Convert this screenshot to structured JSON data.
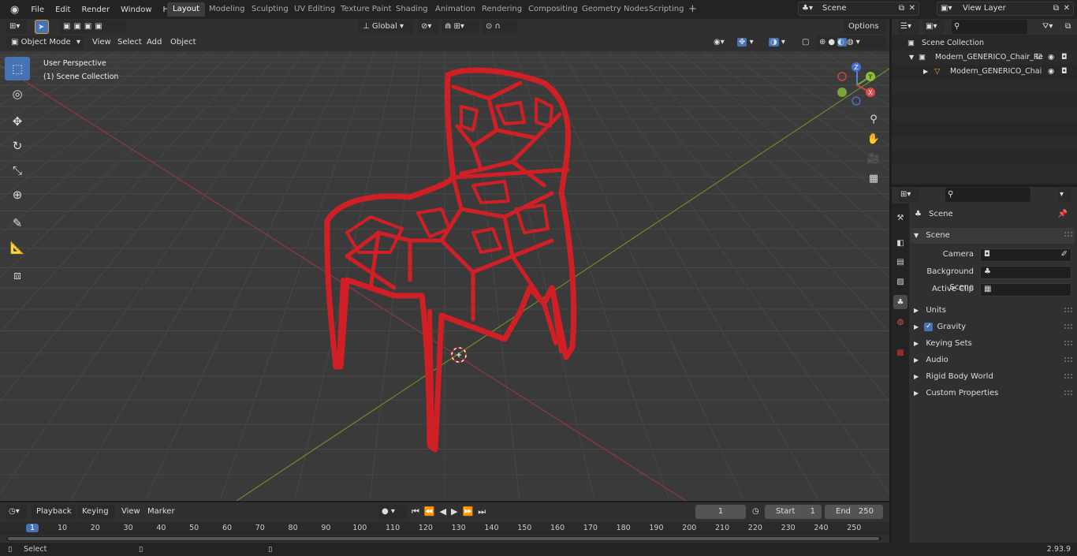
{
  "topbar": {
    "menus": [
      "File",
      "Edit",
      "Render",
      "Window",
      "Help"
    ],
    "workspaces": [
      "Layout",
      "Modeling",
      "Sculpting",
      "UV Editing",
      "Texture Paint",
      "Shading",
      "Animation",
      "Rendering",
      "Compositing",
      "Geometry Nodes",
      "Scripting"
    ],
    "active_workspace": "Layout",
    "add_tab": "+",
    "scene_name": "Scene",
    "view_layer": "View Layer"
  },
  "viewport": {
    "transform_orientation": "Global",
    "options_label": "Options",
    "mode": "Object Mode",
    "menus": [
      "View",
      "Select",
      "Add",
      "Object"
    ],
    "overlay_title": "User Perspective",
    "overlay_collection": "(1) Scene Collection",
    "axis_labels": {
      "z": "Z",
      "y": "Y",
      "x": "X"
    },
    "model_color": "#d11f26",
    "x_axis_color": "#8f3b3b",
    "y_axis_color": "#6a8d2a"
  },
  "outliner": {
    "rows": [
      "Scene Collection",
      "Modern_GENERICO_Chair_Re",
      "Modern_GENERICO_Chai"
    ]
  },
  "properties": {
    "header": "Scene",
    "panel_title": "Scene",
    "fields": [
      {
        "label": "Camera"
      },
      {
        "label": "Background Scene"
      },
      {
        "label": "Active Clip"
      }
    ],
    "sections": [
      "Units",
      "Gravity",
      "Keying Sets",
      "Audio",
      "Rigid Body World",
      "Custom Properties"
    ],
    "gravity_checked": true
  },
  "timeline": {
    "menus": [
      "Playback",
      "Keying",
      "View",
      "Marker"
    ],
    "current_frame": "1",
    "start_label": "Start",
    "start_value": "1",
    "end_label": "End",
    "end_value": "250",
    "ruler": [
      "1",
      "10",
      "20",
      "30",
      "40",
      "50",
      "60",
      "70",
      "80",
      "90",
      "100",
      "110",
      "120",
      "130",
      "140",
      "150",
      "160",
      "170",
      "180",
      "190",
      "200",
      "210",
      "220",
      "230",
      "240",
      "250"
    ]
  },
  "statusbar": {
    "left": "Select",
    "version": "2.93.9"
  }
}
